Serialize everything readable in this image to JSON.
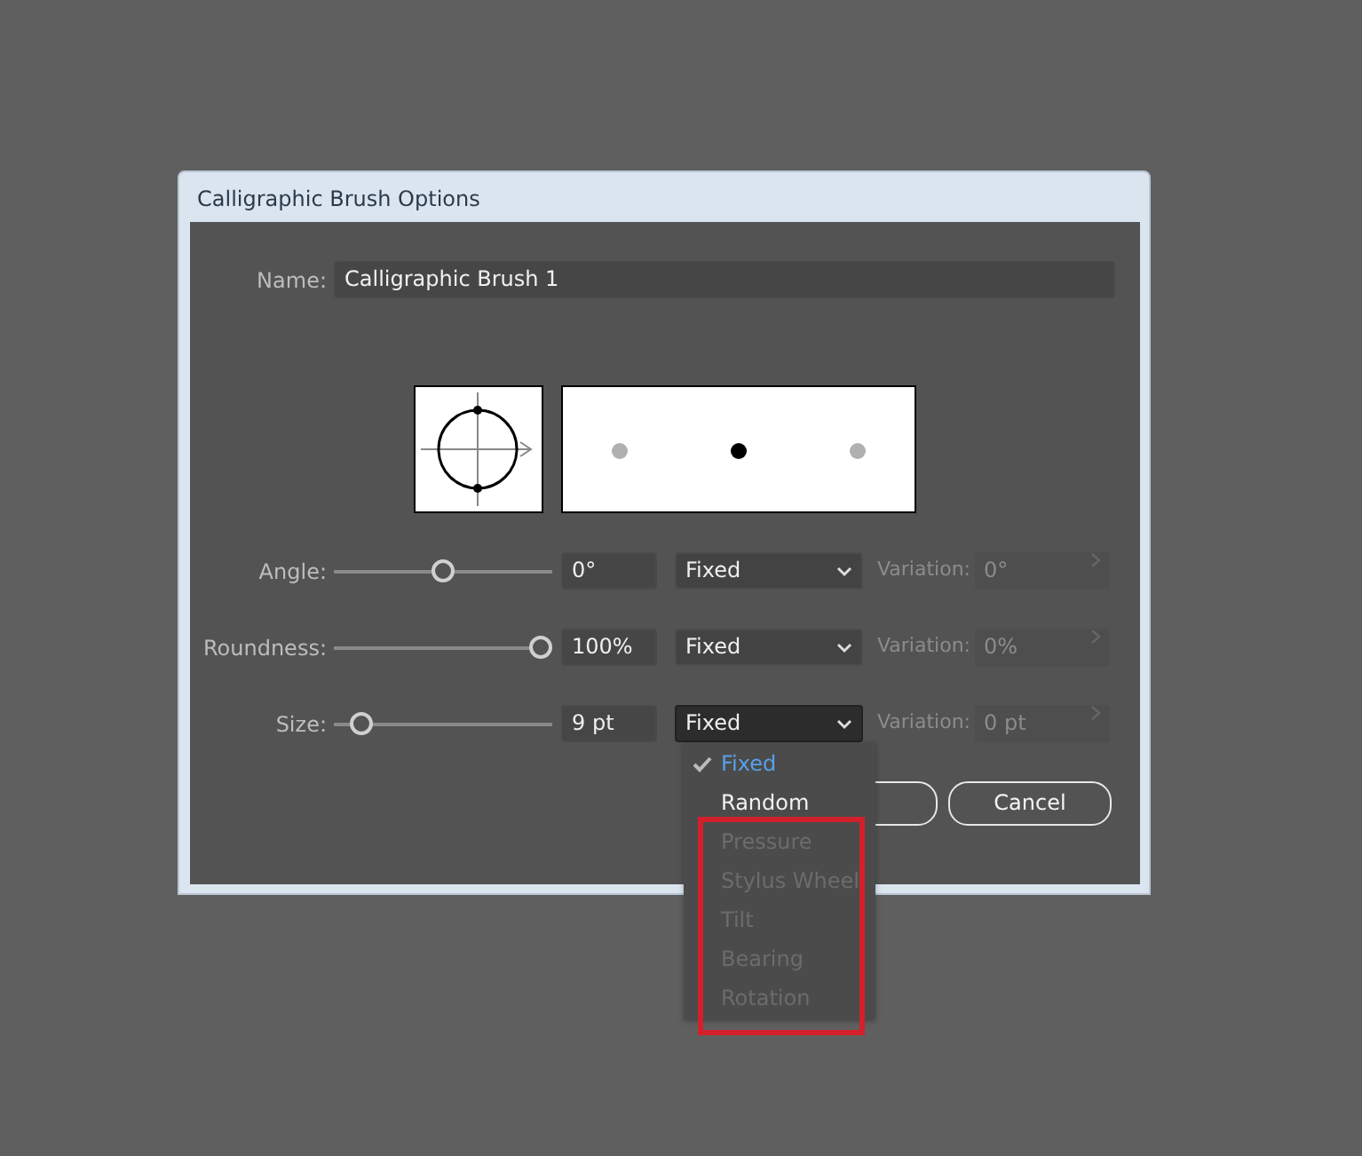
{
  "window": {
    "title": "Calligraphic Brush Options"
  },
  "name": {
    "label": "Name:",
    "value": "Calligraphic Brush 1"
  },
  "rows": [
    {
      "label": "Angle:",
      "level": 0.5,
      "value": "0°",
      "method": "Fixed",
      "open": false,
      "variation_label": "Variation:",
      "variation": "0°",
      "variation_disabled": true
    },
    {
      "label": "Roundness:",
      "level": 1,
      "value": "100%",
      "method": "Fixed",
      "open": false,
      "variation_label": "Variation:",
      "variation": "0%",
      "variation_disabled": true
    },
    {
      "label": "Size:",
      "level": 0.08,
      "value": "9 pt",
      "method": "Fixed",
      "open": true,
      "variation_label": "Variation:",
      "variation": "0 pt",
      "variation_disabled": true
    }
  ],
  "menu": [
    {
      "label": "Fixed",
      "selected": true,
      "disabled": false
    },
    {
      "label": "Random",
      "selected": false,
      "disabled": false
    },
    {
      "label": "Pressure",
      "selected": false,
      "disabled": true
    },
    {
      "label": "Stylus Wheel",
      "selected": false,
      "disabled": true
    },
    {
      "label": "Tilt",
      "selected": false,
      "disabled": true
    },
    {
      "label": "Bearing",
      "selected": false,
      "disabled": true
    },
    {
      "label": "Rotation",
      "selected": false,
      "disabled": true
    }
  ],
  "buttons": [
    {
      "label": "Cancel"
    }
  ]
}
